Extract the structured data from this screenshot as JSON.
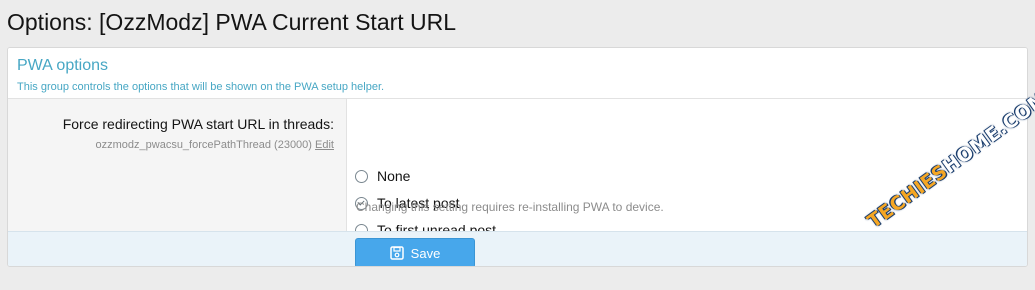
{
  "page": {
    "title": "Options: [OzzModz] PWA Current Start URL"
  },
  "group": {
    "title": "PWA options",
    "description": "This group controls the options that will be shown on the PWA setup helper."
  },
  "option": {
    "label": "Force redirecting PWA start URL in threads:",
    "meta": "ozzmodz_pwacsu_forcePathThread (23000)",
    "edit_label": "Edit",
    "choices": [
      {
        "label": "None",
        "checked": false
      },
      {
        "label": "To latest post",
        "checked": true
      },
      {
        "label": "To first unread post",
        "checked": false
      }
    ],
    "hint": "Changing this setting requires re-installing PWA to device."
  },
  "footer": {
    "save_label": "Save",
    "save_icon": "save-icon"
  },
  "watermark": {
    "part1": "TECHIES",
    "part2": "HOME",
    "part3": ".COM"
  },
  "colors": {
    "accent": "#47a7c4",
    "button": "#47a7eb",
    "footer_bg": "#eaf3f9"
  }
}
